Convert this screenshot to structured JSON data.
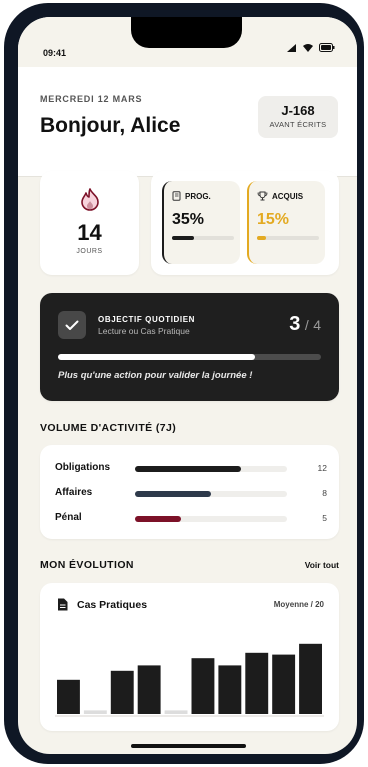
{
  "status": {
    "time": "09:41"
  },
  "header": {
    "date": "MERCREDI 12 MARS",
    "greeting": "Bonjour, Alice",
    "countdown_value": "J-168",
    "countdown_label": "AVANT ÉCRITS"
  },
  "streak": {
    "value": "14",
    "label": "JOURS",
    "icon": "flame-icon"
  },
  "stats": {
    "progress": {
      "label": "PROG.",
      "value": "35%",
      "fraction": 0.35,
      "icon": "book-icon",
      "color": "#1c1c1c"
    },
    "acquired": {
      "label": "ACQUIS",
      "value": "15%",
      "fraction": 0.15,
      "icon": "trophy-icon",
      "color": "#e3aa22"
    }
  },
  "daily_goal": {
    "title": "OBJECTIF QUOTIDIEN",
    "subtitle": "Lecture ou Cas Pratique",
    "done": "3",
    "separator": "/",
    "total": "4",
    "fraction": 0.75,
    "message": "Plus qu'une action pour valider la journée !"
  },
  "activity": {
    "title": "VOLUME D'ACTIVITÉ (7J)",
    "items": [
      {
        "label": "Obligations",
        "value": "12",
        "fraction": 0.7,
        "color": "#1c1c1c"
      },
      {
        "label": "Affaires",
        "value": "8",
        "fraction": 0.5,
        "color": "#2e3a4b"
      },
      {
        "label": "Pénal",
        "value": "5",
        "fraction": 0.3,
        "color": "#7c1128"
      }
    ]
  },
  "evolution": {
    "title": "MON ÉVOLUTION",
    "see_all": "Voir tout",
    "card_title": "Cas Pratiques",
    "card_meta": "Moyenne / 20"
  },
  "chart_data": {
    "type": "bar",
    "title": "Cas Pratiques",
    "ylabel": "Moyenne / 20",
    "ylim": [
      0,
      20
    ],
    "values": [
      9.5,
      1,
      12,
      13.5,
      1,
      15.5,
      13.5,
      17,
      16.5,
      19.5
    ],
    "colors": [
      "#1c1c1c",
      "#dddddd",
      "#1c1c1c",
      "#1c1c1c",
      "#dddddd",
      "#1c1c1c",
      "#1c1c1c",
      "#1c1c1c",
      "#1c1c1c",
      "#1c1c1c"
    ]
  }
}
